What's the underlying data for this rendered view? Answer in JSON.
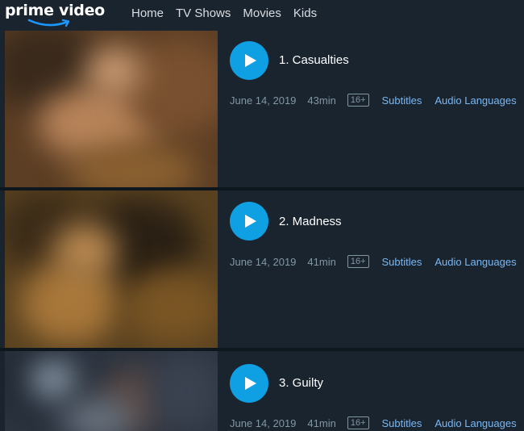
{
  "header": {
    "logo_text": "prime video",
    "nav": [
      "Home",
      "TV Shows",
      "Movies",
      "Kids"
    ]
  },
  "episodes": [
    {
      "title": "1. Casualties",
      "date": "June 14, 2019",
      "duration": "43min",
      "rating": "16+",
      "subtitles": "Subtitles",
      "audio": "Audio Languages"
    },
    {
      "title": "2. Madness",
      "date": "June 14, 2019",
      "duration": "41min",
      "rating": "16+",
      "subtitles": "Subtitles",
      "audio": "Audio Languages"
    },
    {
      "title": "3. Guilty",
      "date": "June 14, 2019",
      "duration": "41min",
      "rating": "16+",
      "subtitles": "Subtitles",
      "audio": "Audio Languages"
    }
  ],
  "colors": {
    "background": "#0f171e",
    "row_background": "#1a242f",
    "play_button": "#0f9fe3",
    "link": "#79b8f3",
    "meta_text": "#8197a4"
  },
  "icons": {
    "play": "play-icon",
    "logo_smile": "smile-arrow-icon"
  }
}
